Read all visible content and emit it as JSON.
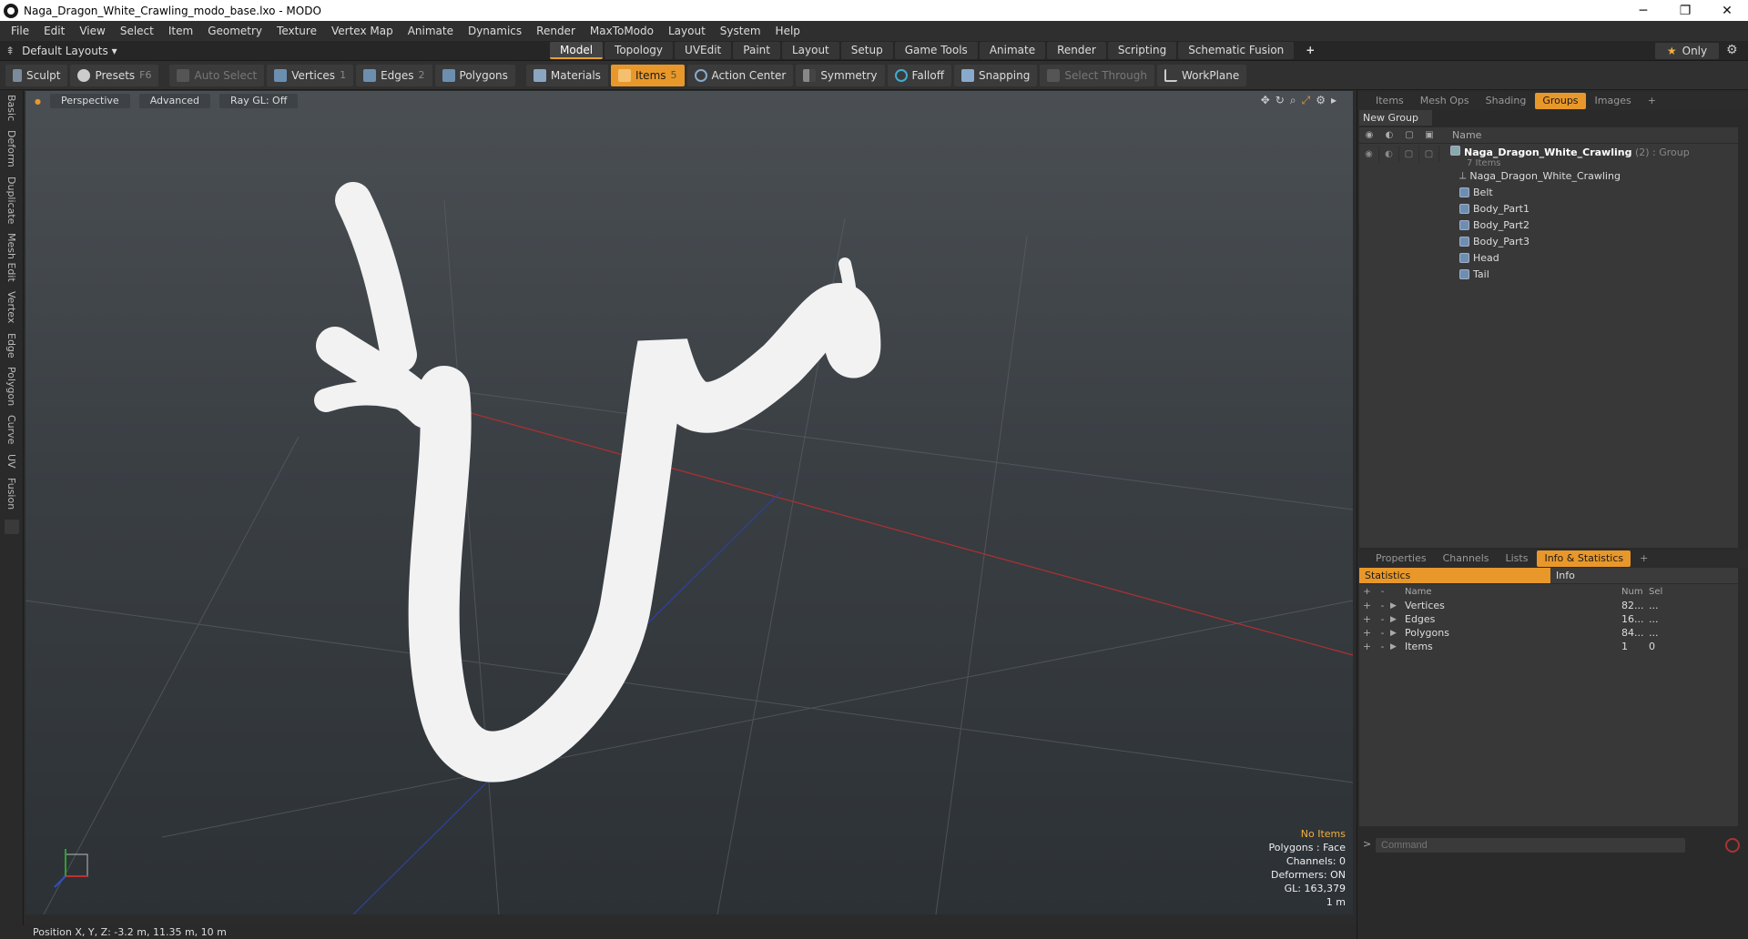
{
  "window": {
    "title": "Naga_Dragon_White_Crawling_modo_base.lxo - MODO"
  },
  "menu": [
    "File",
    "Edit",
    "View",
    "Select",
    "Item",
    "Geometry",
    "Texture",
    "Vertex Map",
    "Animate",
    "Dynamics",
    "Render",
    "MaxToModo",
    "Layout",
    "System",
    "Help"
  ],
  "layout": {
    "selector": "Default Layouts ▾",
    "only_label": "Only"
  },
  "tabs": [
    {
      "label": "Model",
      "active": true
    },
    {
      "label": "Topology"
    },
    {
      "label": "UVEdit"
    },
    {
      "label": "Paint"
    },
    {
      "label": "Layout"
    },
    {
      "label": "Setup"
    },
    {
      "label": "Game Tools"
    },
    {
      "label": "Animate"
    },
    {
      "label": "Render"
    },
    {
      "label": "Scripting"
    },
    {
      "label": "Schematic Fusion"
    }
  ],
  "toolbar": {
    "sculpt": "Sculpt",
    "presets": "Presets",
    "presets_key": "F6",
    "auto_select": "Auto Select",
    "vertices": "Vertices",
    "vertices_key": "1",
    "edges": "Edges",
    "edges_key": "2",
    "polygons": "Polygons",
    "materials": "Materials",
    "items": "Items",
    "items_key": "5",
    "action_center": "Action Center",
    "symmetry": "Symmetry",
    "falloff": "Falloff",
    "snapping": "Snapping",
    "select_through": "Select Through",
    "workplane": "WorkPlane"
  },
  "left_tabs": [
    "Basic",
    "Deform",
    "Duplicate",
    "Mesh Edit",
    "Vertex",
    "Edge",
    "Polygon",
    "Curve",
    "UV",
    "Fusion"
  ],
  "viewport": {
    "perspective": "Perspective",
    "advanced": "Advanced",
    "raygl": "Ray GL: Off",
    "hud": {
      "no_items": "No Items",
      "polygons": "Polygons : Face",
      "channels": "Channels: 0",
      "deformers": "Deformers: ON",
      "gl": "GL: 163,379",
      "scale": "1 m"
    }
  },
  "status": {
    "position": "Position X, Y, Z:   -3.2 m, 11.35 m, 10 m"
  },
  "panel_top": {
    "tabs": [
      "Items",
      "Mesh Ops",
      "Shading",
      "Groups",
      "Images"
    ],
    "active": "Groups",
    "new_group": "New Group",
    "name_header": "Name",
    "group_name": "Naga_Dragon_White_Crawling",
    "group_suffix": "(2) : Group",
    "group_count": "7 Items",
    "items": [
      "Naga_Dragon_White_Crawling",
      "Belt",
      "Body_Part1",
      "Body_Part2",
      "Body_Part3",
      "Head",
      "Tail"
    ]
  },
  "panel_bottom": {
    "tabs": [
      "Properties",
      "Channels",
      "Lists",
      "Info & Statistics"
    ],
    "active": "Info & Statistics",
    "subtabs": [
      "Statistics",
      "Info"
    ],
    "headers": {
      "name": "Name",
      "num": "Num",
      "sel": "Sel"
    },
    "rows": [
      {
        "name": "Vertices",
        "num": "82...",
        "sel": "..."
      },
      {
        "name": "Edges",
        "num": "16...",
        "sel": "..."
      },
      {
        "name": "Polygons",
        "num": "84...",
        "sel": "..."
      },
      {
        "name": "Items",
        "num": "1",
        "sel": "0"
      }
    ],
    "command_placeholder": "Command"
  }
}
